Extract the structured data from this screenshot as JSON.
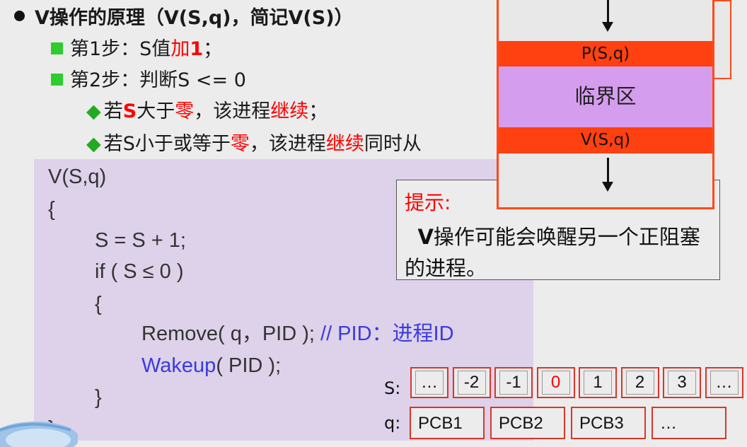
{
  "bullets": {
    "title_pre": "V操作的原理（",
    "title_bold": "V(S,q)",
    "title_mid": "，简记",
    "title_bold2": "V(S)",
    "title_post": "）",
    "step1_pre": "第1步：S值",
    "step1_red": "加",
    "step1_red_bold": "1",
    "step1_post": "；",
    "step2": "第2步：判断S <= 0",
    "sub1_pre": "若",
    "sub1_red_bold": "S",
    "sub1_mid": "大于",
    "sub1_red": "零",
    "sub1_mid2": "，该进程",
    "sub1_red2": "继续",
    "sub1_post": "；",
    "sub2_pre": "若S小于或等于",
    "sub2_red": "零",
    "sub2_mid": "，该进程",
    "sub2_red2": "继续",
    "sub2_post": "同时从"
  },
  "code": {
    "line1": "V(S,q)",
    "line2": "{",
    "line3": "S = S + 1;",
    "line4": "if ( S ≤ 0 )",
    "line5": "{",
    "line6_a": "Remove( q，PID );",
    "line6_b": " // PID：进程ID",
    "line7_a": "Wakeup",
    "line7_b": "( PID );",
    "line8": "}",
    "line9": "}"
  },
  "tip": {
    "title": "提示:",
    "body_bold": "V",
    "body": "操作可能会唤醒另一个正阻塞的进程。"
  },
  "diagram": {
    "p_label": "P(S,q)",
    "cs_label": "临界区",
    "v_label": "V(S,q)"
  },
  "s_row": {
    "label": "S:",
    "cells": [
      "…",
      "-2",
      "-1",
      "0",
      "1",
      "2",
      "3",
      "…"
    ],
    "highlight_color": "#ff0000"
  },
  "q_row": {
    "label": "q:",
    "cells": [
      "PCB1",
      "PCB2",
      "PCB3",
      "…"
    ]
  }
}
